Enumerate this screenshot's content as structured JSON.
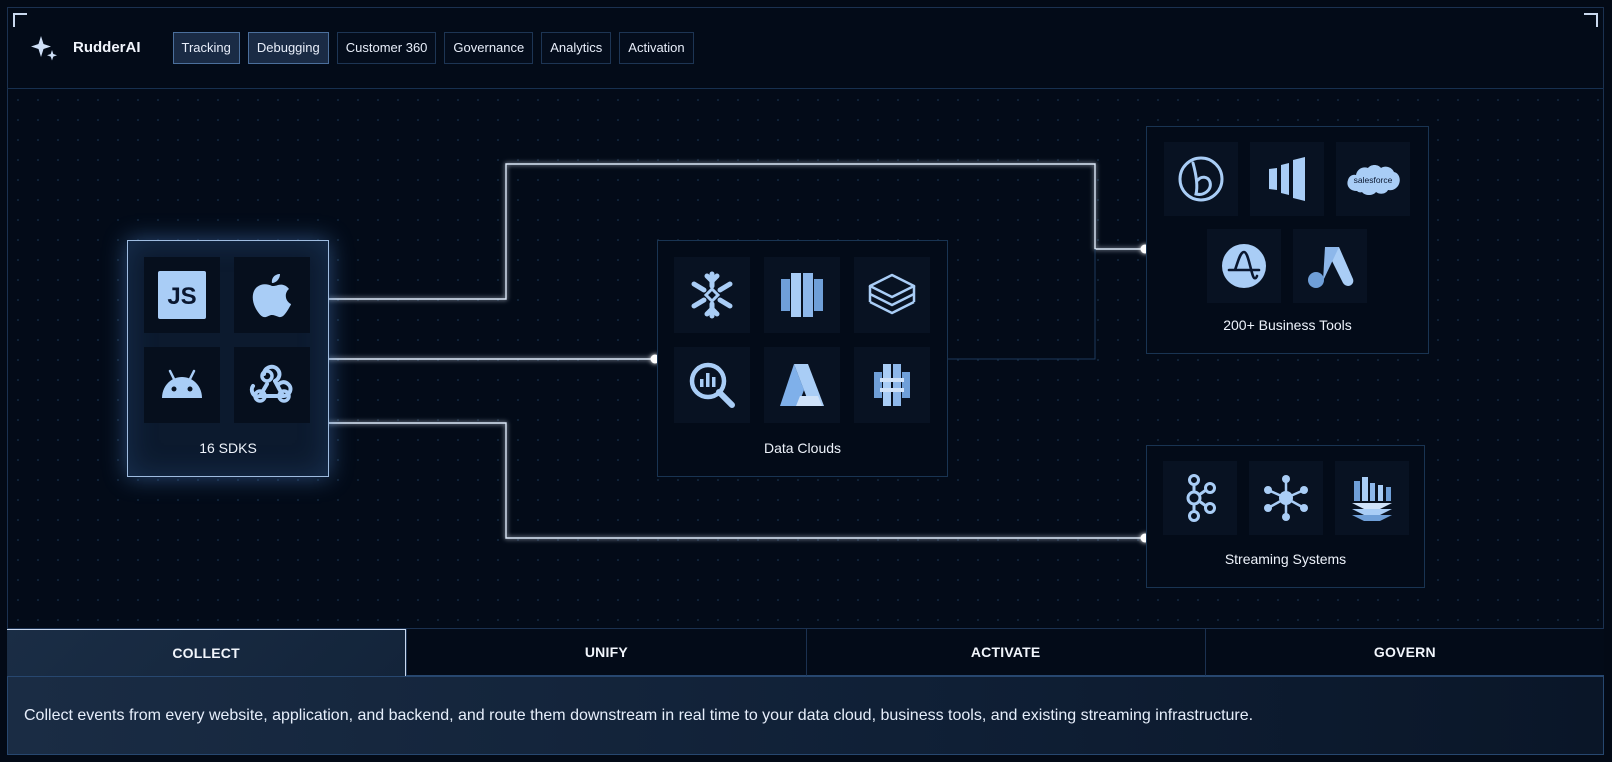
{
  "brand": {
    "name": "RudderAI",
    "icon": "sparkle-icon"
  },
  "nav": [
    {
      "label": "Tracking",
      "active": true
    },
    {
      "label": "Debugging",
      "active": true
    },
    {
      "label": "Customer 360",
      "active": false
    },
    {
      "label": "Governance",
      "active": false
    },
    {
      "label": "Analytics",
      "active": false
    },
    {
      "label": "Activation",
      "active": false
    }
  ],
  "diagram": {
    "sources": {
      "label": "16 SDKS",
      "icons": [
        "javascript-icon",
        "apple-icon",
        "android-icon",
        "webhook-icon"
      ]
    },
    "warehouses": {
      "label": "Data Clouds",
      "icons": [
        "snowflake-icon",
        "redshift-icon",
        "databricks-icon",
        "bigquery-icon",
        "azure-synapse-icon",
        "aws-glue-icon"
      ]
    },
    "business_tools": {
      "label": "200+ Business Tools",
      "icons": [
        "braze-icon",
        "mixpanel-icon",
        "salesforce-icon",
        "amplitude-icon",
        "google-ads-icon"
      ],
      "salesforce_text": "salesforce"
    },
    "streaming": {
      "label": "Streaming Systems",
      "icons": [
        "kafka-icon",
        "event-hub-icon",
        "kinesis-icon"
      ]
    },
    "js_text": "JS"
  },
  "tabs": [
    {
      "label": "COLLECT",
      "active": true
    },
    {
      "label": "UNIFY",
      "active": false
    },
    {
      "label": "ACTIVATE",
      "active": false
    },
    {
      "label": "GOVERN",
      "active": false
    }
  ],
  "description": "Collect events from every website, application, and backend, and route them downstream in real time to your data cloud, business tools, and existing streaming infrastructure.",
  "colors": {
    "accent": "#9dc4f5",
    "background": "#030b18",
    "line": "#dce8f8"
  }
}
